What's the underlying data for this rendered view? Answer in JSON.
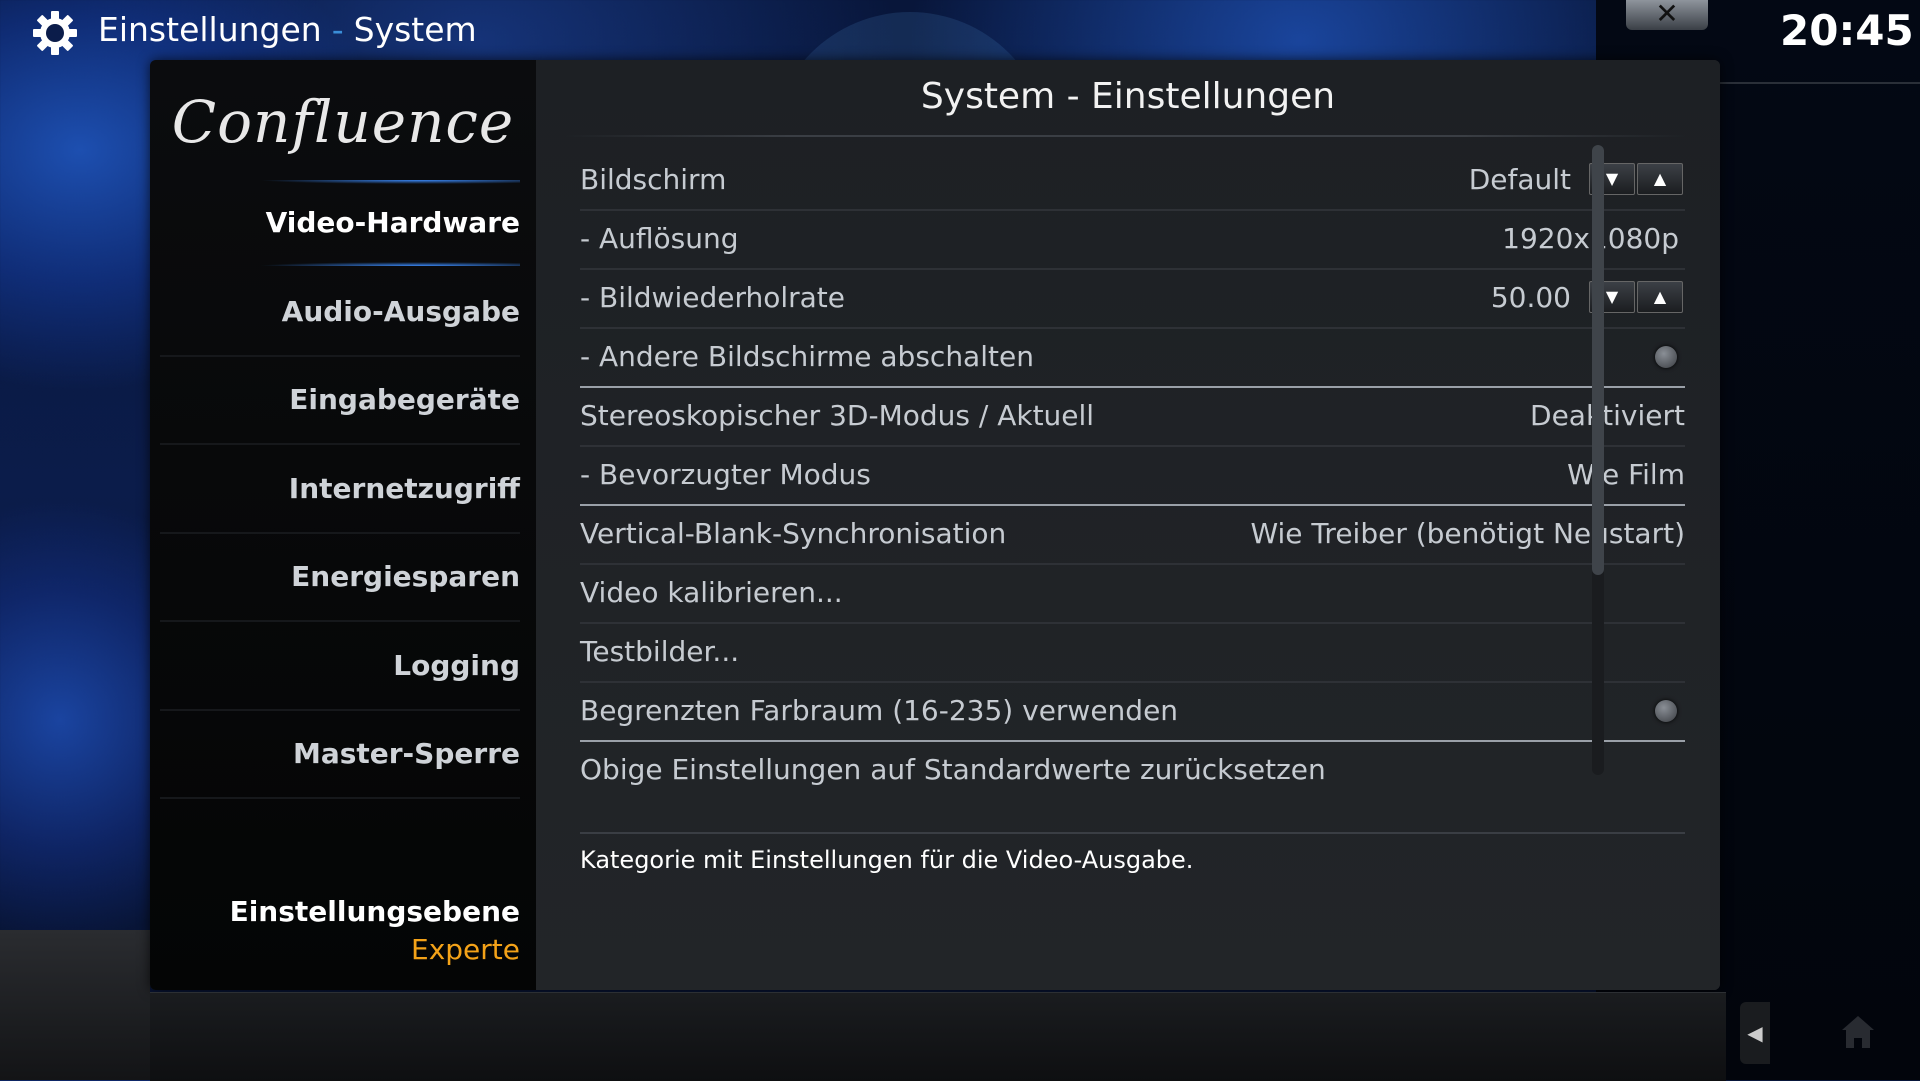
{
  "header": {
    "section": "Einstellungen",
    "separator": "-",
    "subsection": "System",
    "clock": "20:45",
    "close_label": "✕"
  },
  "sidebar": {
    "logo_text": "Confluence",
    "items": [
      {
        "label": "Video-Hardware",
        "active": true
      },
      {
        "label": "Audio-Ausgabe"
      },
      {
        "label": "Eingabegeräte"
      },
      {
        "label": "Internetzugriff"
      },
      {
        "label": "Energiesparen"
      },
      {
        "label": "Logging"
      },
      {
        "label": "Master-Sperre"
      }
    ],
    "level_label": "Einstellungsebene",
    "level_value": "Experte"
  },
  "content": {
    "title": "System - Einstellungen",
    "rows": [
      {
        "label": "Bildschirm",
        "value": "Default",
        "control": "spinner"
      },
      {
        "label": "- Auflösung",
        "value": "1920x1080p"
      },
      {
        "label": "- Bildwiederholrate",
        "value": "50.00",
        "control": "spinner"
      },
      {
        "label": "- Andere Bildschirme abschalten",
        "control": "radio"
      },
      {
        "label": "Stereoskopischer 3D-Modus / Aktuell",
        "value": "Deaktiviert"
      },
      {
        "label": "- Bevorzugter Modus",
        "value": "Wie Film"
      },
      {
        "label": "Vertical-Blank-Synchronisation",
        "value": "Wie Treiber (benötigt Neustart)"
      },
      {
        "label": "Video kalibrieren..."
      },
      {
        "label": "Testbilder..."
      },
      {
        "label": "Begrenzten Farbraum (16-235) verwenden",
        "control": "radio"
      },
      {
        "label": "Obige Einstellungen auf Standardwerte zurücksetzen"
      }
    ],
    "description": "Kategorie mit Einstellungen für die Video-Ausgabe."
  },
  "colors": {
    "accent_blue": "#3a8ed8",
    "level_orange": "#f3a218"
  },
  "icons": {
    "settings": "gear-icon",
    "spin_down": "▼",
    "spin_up": "▲",
    "back": "◀",
    "home": "home-icon"
  }
}
